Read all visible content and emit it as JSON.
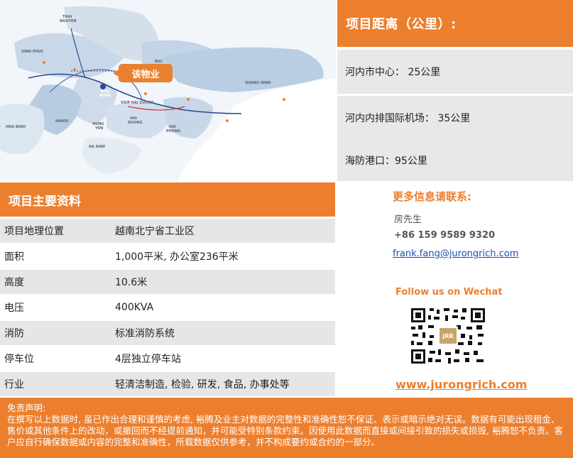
{
  "map": {
    "callout": "该物业",
    "labels": {
      "thai_nguyen": "THAI\nNGUYEN",
      "vinh_phuc": "VINH PHUC",
      "bac_giang": "BAC\nGIANG",
      "bac_ninh": "BAC\nNINH",
      "quang_ninh": "QUANG NINH",
      "hanoi": "HANOI",
      "hung_yen": "HUNG\nYEN",
      "hai_duong": "HAI\nDUONG",
      "hai_phong": "HAI\nPHONG",
      "hoa_binh": "HOA BINH",
      "ha_nam": "HA NAM",
      "vsip": "VSIP HAI DUONG"
    }
  },
  "distances": {
    "title": "项目距离（公里）:",
    "items": [
      {
        "text": "河内市中心： 25公里"
      },
      {
        "text": "河内内排国际机场： 35公里"
      },
      {
        "text": "海防港口：95公里"
      }
    ]
  },
  "info": {
    "title": "项目主要资料",
    "rows": [
      {
        "key": "项目地理位置",
        "value": "越南北宁省工业区"
      },
      {
        "key": "面积",
        "value": "1,000平米, 办公室236平米"
      },
      {
        "key": "高度",
        "value": "10.6米"
      },
      {
        "key": "电压",
        "value": "400KVA"
      },
      {
        "key": "消防",
        "value": "标准消防系统"
      },
      {
        "key": "停车位",
        "value": "4层独立停车站"
      },
      {
        "key": "行业",
        "value": "轻清洁制造, 检验, 研发, 食品, 办事处等"
      }
    ]
  },
  "contact": {
    "title": "更多信息请联系:",
    "name": "房先生",
    "phone": "+86 159 9589 9320",
    "email": "frank.fang@jurongrich.com",
    "follow": "Follow us on Wechat",
    "qr_center": "JRR",
    "website": "www.jurongrich.com"
  },
  "disclaimer": {
    "title": "免责声明:",
    "body": "在撰写以上数据时, 虽已作出合理和谨慎的考虑, 裕腾及业主对数据的完整性和准确性恕不保证、表示或暗示绝对无误。数据有可能出现租金、售价或其他条件上的改动，或撤回而不经提前通知，并可能受特别条款约束。因使用此数据而直接或间接引致的损失或损毁, 裕腾恕不负责。客户应自行确保数据或内容的完整和准确性，所载数据仅供参考，并不构成要约或合约的一部分。"
  },
  "colors": {
    "accent": "#ec7f2e",
    "row_shade": "#e6e6e6",
    "link": "#1f4fa8"
  }
}
